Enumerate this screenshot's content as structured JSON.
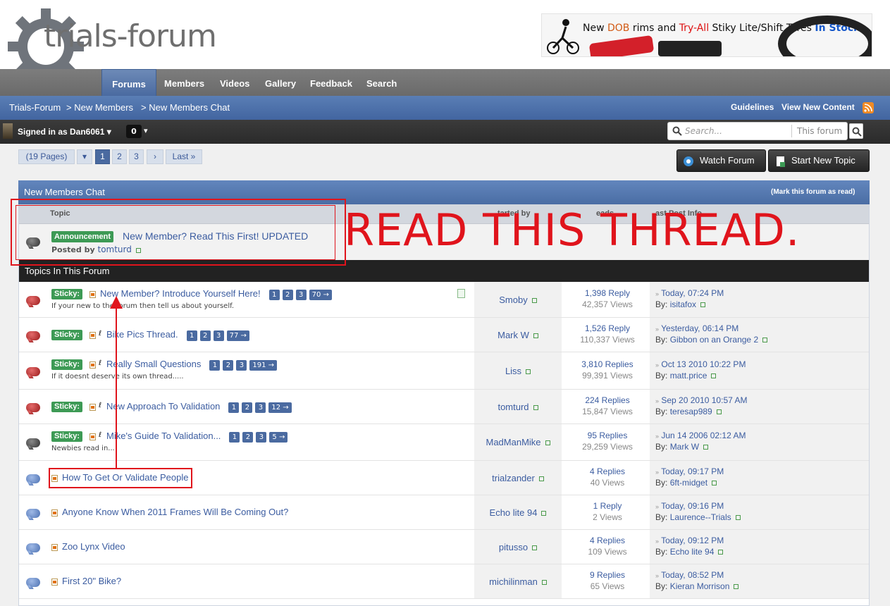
{
  "site": {
    "logo_text": "trials-forum"
  },
  "banner": {
    "prefix": "New ",
    "highlight1": "DOB",
    "mid1": " rims and ",
    "highlight2": "Try-All",
    "mid2": " Stiky Lite/Shift Tyres ",
    "highlight3": "In Stock"
  },
  "nav": {
    "tabs": [
      "Forums",
      "Members",
      "Videos",
      "Gallery",
      "Feedback",
      "Search"
    ]
  },
  "breadcrumb": {
    "items": [
      "Trials-Forum",
      "> New Members",
      "> New Members Chat"
    ],
    "right": [
      "Guidelines",
      "View New Content"
    ]
  },
  "userbar": {
    "signed_in": "Signed in as Dan6061",
    "notifications": "0"
  },
  "search": {
    "placeholder": "Search...",
    "scope": "This forum"
  },
  "pagination": {
    "pages_label": "(19 Pages)",
    "pages": [
      "1",
      "2",
      "3"
    ],
    "next": "›",
    "last": "Last »"
  },
  "actions": {
    "watch": "Watch Forum",
    "new_topic": "Start New Topic"
  },
  "forum": {
    "title": "New Members Chat",
    "mark_read": "(Mark this forum as read)",
    "columns": {
      "topic": "Topic",
      "started_by": "tarted by",
      "stats": "eads",
      "last_post": "ast Post Info"
    },
    "announcement": {
      "badge": "Announcement",
      "title": "New Member? Read This First! UPDATED",
      "posted_by_label": "Posted by",
      "author": "tomturd"
    },
    "section_title": "Topics In This Forum",
    "topics": [
      {
        "sticky": "Sticky:",
        "title": "New Member? Introduce Yourself Here!",
        "desc": "If your new to the forum then tell us about yourself.",
        "pages": [
          "1",
          "2",
          "3",
          "70 →"
        ],
        "starter": "Smoby",
        "replies": "1,398 Reply",
        "views": "42,357 Views",
        "last_date": "Today, 07:24 PM",
        "by_label": "By:",
        "last_by": "isitafox"
      },
      {
        "sticky": "Sticky:",
        "title": "Bike Pics Thread.",
        "desc": "",
        "pages": [
          "1",
          "2",
          "3",
          "77 →"
        ],
        "starter": "Mark W",
        "replies": "1,526 Reply",
        "views": "110,337 Views",
        "last_date": "Yesterday, 06:14 PM",
        "by_label": "By:",
        "last_by": "Gibbon on an Orange 2"
      },
      {
        "sticky": "Sticky:",
        "title": "Really Small Questions",
        "desc": "If it doesnt deserve its own thread.....",
        "pages": [
          "1",
          "2",
          "3",
          "191 →"
        ],
        "starter": "Liss",
        "replies": "3,810 Replies",
        "views": "99,391 Views",
        "last_date": "Oct 13 2010 10:22 PM",
        "by_label": "By:",
        "last_by": "matt.price"
      },
      {
        "sticky": "Sticky:",
        "title": "New Approach To Validation",
        "desc": "",
        "pages": [
          "1",
          "2",
          "3",
          "12 →"
        ],
        "starter": "tomturd",
        "replies": "224 Replies",
        "views": "15,847 Views",
        "last_date": "Sep 20 2010 10:57 AM",
        "by_label": "By:",
        "last_by": "teresap989"
      },
      {
        "sticky": "Sticky:",
        "title": "Mike's Guide To Validation...",
        "desc": "Newbies read in...",
        "pages": [
          "1",
          "2",
          "3",
          "5 →"
        ],
        "starter": "MadManMike",
        "replies": "95 Replies",
        "views": "29,259 Views",
        "last_date": "Jun 14 2006 02:12 AM",
        "by_label": "By:",
        "last_by": "Mark W"
      },
      {
        "sticky": "",
        "title": "How To Get Or Validate People",
        "desc": "",
        "pages": [],
        "starter": "trialzander",
        "replies": "4 Replies",
        "views": "40 Views",
        "last_date": "Today, 09:17 PM",
        "by_label": "By:",
        "last_by": "6ft-midget"
      },
      {
        "sticky": "",
        "title": "Anyone Know When 2011 Frames Will Be Coming Out?",
        "desc": "",
        "pages": [],
        "starter": "Echo lite 94",
        "replies": "1 Reply",
        "views": "2 Views",
        "last_date": "Today, 09:16 PM",
        "by_label": "By:",
        "last_by": "Laurence--Trials"
      },
      {
        "sticky": "",
        "title": "Zoo Lynx Video",
        "desc": "",
        "pages": [],
        "starter": "pitusso",
        "replies": "4 Replies",
        "views": "109 Views",
        "last_date": "Today, 09:12 PM",
        "by_label": "By:",
        "last_by": "Echo lite 94"
      },
      {
        "sticky": "",
        "title": "First 20\" Bike?",
        "desc": "",
        "pages": [],
        "starter": "michilinman",
        "replies": "9 Replies",
        "views": "65 Views",
        "last_date": "Today, 08:52 PM",
        "by_label": "By:",
        "last_by": "Kieran Morrison"
      }
    ]
  },
  "annotation": {
    "text": "READ THIS THREAD.",
    "color": "#e0141c"
  }
}
